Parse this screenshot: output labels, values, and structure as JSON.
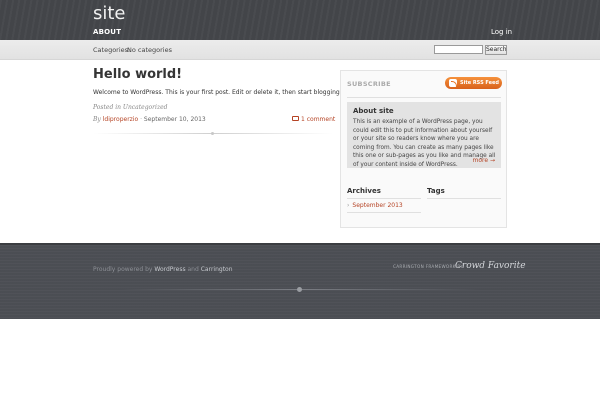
{
  "header": {
    "site_title": "site",
    "nav_about": "About",
    "login": "Log in"
  },
  "subbar": {
    "categories_label": "Categories:",
    "categories_value": "No categories",
    "search_value": "",
    "search_button": "Search"
  },
  "post": {
    "title": "Hello world!",
    "body": "Welcome to WordPress. This is your first post. Edit or delete it, then start blogging!",
    "posted_in": "Posted in Uncategorized",
    "by": "By",
    "author": "ldiproperzio",
    "separator": "·",
    "date": "September 10, 2013",
    "comments": "1 comment"
  },
  "sidebar": {
    "subscribe": "Subscribe",
    "rss_button": "Site RSS Feed",
    "about_title": "About site",
    "about_text": "This is an example of a WordPress page, you could edit this to put information about yourself or your site so readers know where you are coming from. You can create as many pages like this one or sub-pages as you like and manage all of your content inside of WordPress.",
    "about_more": "more →",
    "archives_title": "Archives",
    "archive_items": [
      "September 2013"
    ],
    "tags_title": "Tags"
  },
  "footer": {
    "proudly": "Proudly powered by",
    "wordpress": "WordPress",
    "and": "and",
    "carrington": "Carrington",
    "framework_by": "Carrington Framework by",
    "crowd_favorite": "Crowd Favorite"
  },
  "colors": {
    "header_bg": "#45474b",
    "link_accent": "#b54324",
    "rss_orange": "#e8701e",
    "footer_bg": "#4c4f55"
  }
}
